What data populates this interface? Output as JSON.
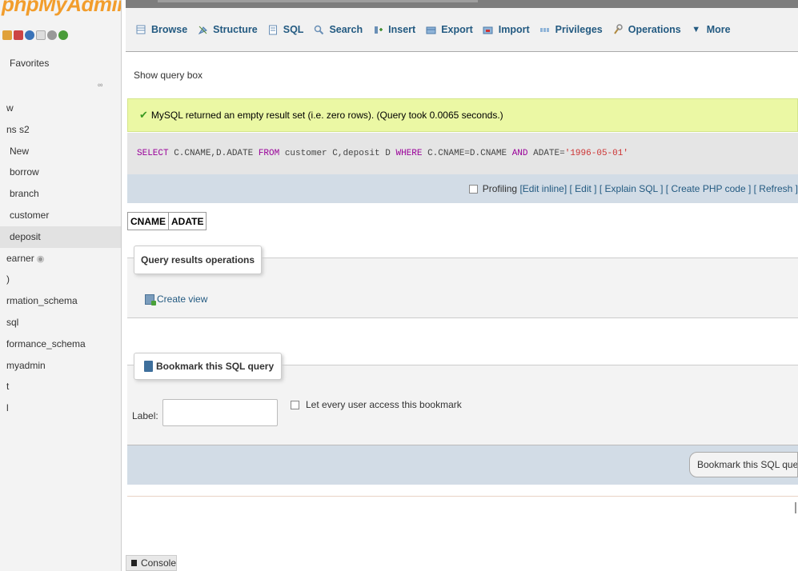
{
  "sidebar": {
    "logo": "phpMyAdmin",
    "favorites_label": "Favorites",
    "fav_link": "∞",
    "items": [
      {
        "label": "w"
      },
      {
        "label": "ns s2"
      },
      {
        "label": "New"
      },
      {
        "label": "borrow"
      },
      {
        "label": "branch"
      },
      {
        "label": "customer"
      },
      {
        "label": "deposit",
        "active": true
      },
      {
        "label": "earner"
      },
      {
        "label": ")"
      },
      {
        "label": "rmation_schema"
      },
      {
        "label": "sql"
      },
      {
        "label": "formance_schema"
      },
      {
        "label": "myadmin"
      },
      {
        "label": "t"
      },
      {
        "label": "l"
      }
    ]
  },
  "tabs": [
    {
      "label": "Browse",
      "icon": "browse-icon"
    },
    {
      "label": "Structure",
      "icon": "structure-icon"
    },
    {
      "label": "SQL",
      "icon": "sql-icon"
    },
    {
      "label": "Search",
      "icon": "search-icon"
    },
    {
      "label": "Insert",
      "icon": "insert-icon"
    },
    {
      "label": "Export",
      "icon": "export-icon"
    },
    {
      "label": "Import",
      "icon": "import-icon"
    },
    {
      "label": "Privileges",
      "icon": "privileges-icon"
    },
    {
      "label": "Operations",
      "icon": "operations-icon"
    },
    {
      "label": "More",
      "icon": "chevron-down-icon"
    }
  ],
  "content": {
    "show_query_box": "Show query box",
    "success_message": "MySQL returned an empty result set (i.e. zero rows). (Query took 0.0065 seconds.)",
    "sql": {
      "p1_kw": "SELECT",
      "p2": " C.CNAME,D.ADATE ",
      "p3_kw": "FROM",
      "p4": " customer C,deposit D ",
      "p5_kw": "WHERE",
      "p6": " C.CNAME=D.CNAME ",
      "p7_kw": "AND",
      "p8": " ADATE=",
      "p9_str": "'1996-05-01'"
    },
    "actions": {
      "profiling": "Profiling",
      "edit_inline": "[Edit inline]",
      "edit": "[ Edit ]",
      "explain": "[ Explain SQL ]",
      "create_php": "[ Create PHP code ]",
      "refresh": "[ Refresh ]"
    },
    "columns": [
      "CNAME",
      "ADATE"
    ],
    "qro_title": "Query results operations",
    "create_view": "Create view",
    "bookmark_title": "Bookmark this SQL query",
    "label_text": "Label:",
    "label_value": "",
    "share_label": "Let every user access this bookmark",
    "bookmark_button": "Bookmark this SQL query"
  },
  "console": {
    "label": "Console"
  },
  "colors": {
    "link": "#235a81",
    "success_bg": "#ebf8a4",
    "sql_bg": "#e5e5e5",
    "action_bar_bg": "#d2dce6"
  }
}
